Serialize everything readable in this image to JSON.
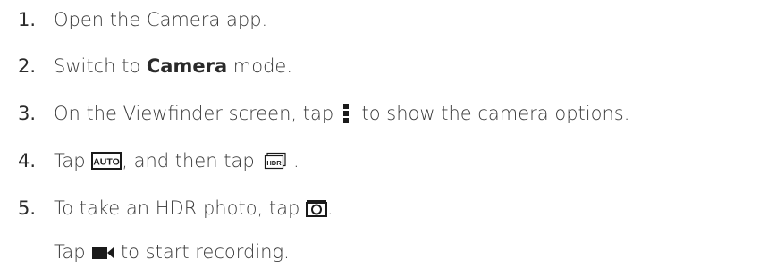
{
  "steps": [
    {
      "number": "1.",
      "parts": {
        "t1": "Open the Camera app."
      }
    },
    {
      "number": "2.",
      "parts": {
        "t1": "Switch to ",
        "bold": "Camera",
        "t2": " mode."
      }
    },
    {
      "number": "3.",
      "parts": {
        "t1": "On the Viewfinder screen, tap ",
        "icon": "menu-dots-icon",
        "t2": " to show the camera options."
      }
    },
    {
      "number": "4.",
      "parts": {
        "t1": "Tap ",
        "icon1": "auto-mode-icon",
        "icon1_label": "AUTO",
        "t2": ", and then tap ",
        "icon2": "hdr-mode-icon",
        "icon2_label": "HDR",
        "t3": " ."
      }
    },
    {
      "number": "5.",
      "parts": {
        "t1": "To take an HDR photo, tap ",
        "icon": "camera-shutter-icon",
        "t2": "."
      }
    }
  ],
  "note": {
    "t1": "Tap ",
    "icon": "video-record-icon",
    "t2": " to start recording."
  }
}
